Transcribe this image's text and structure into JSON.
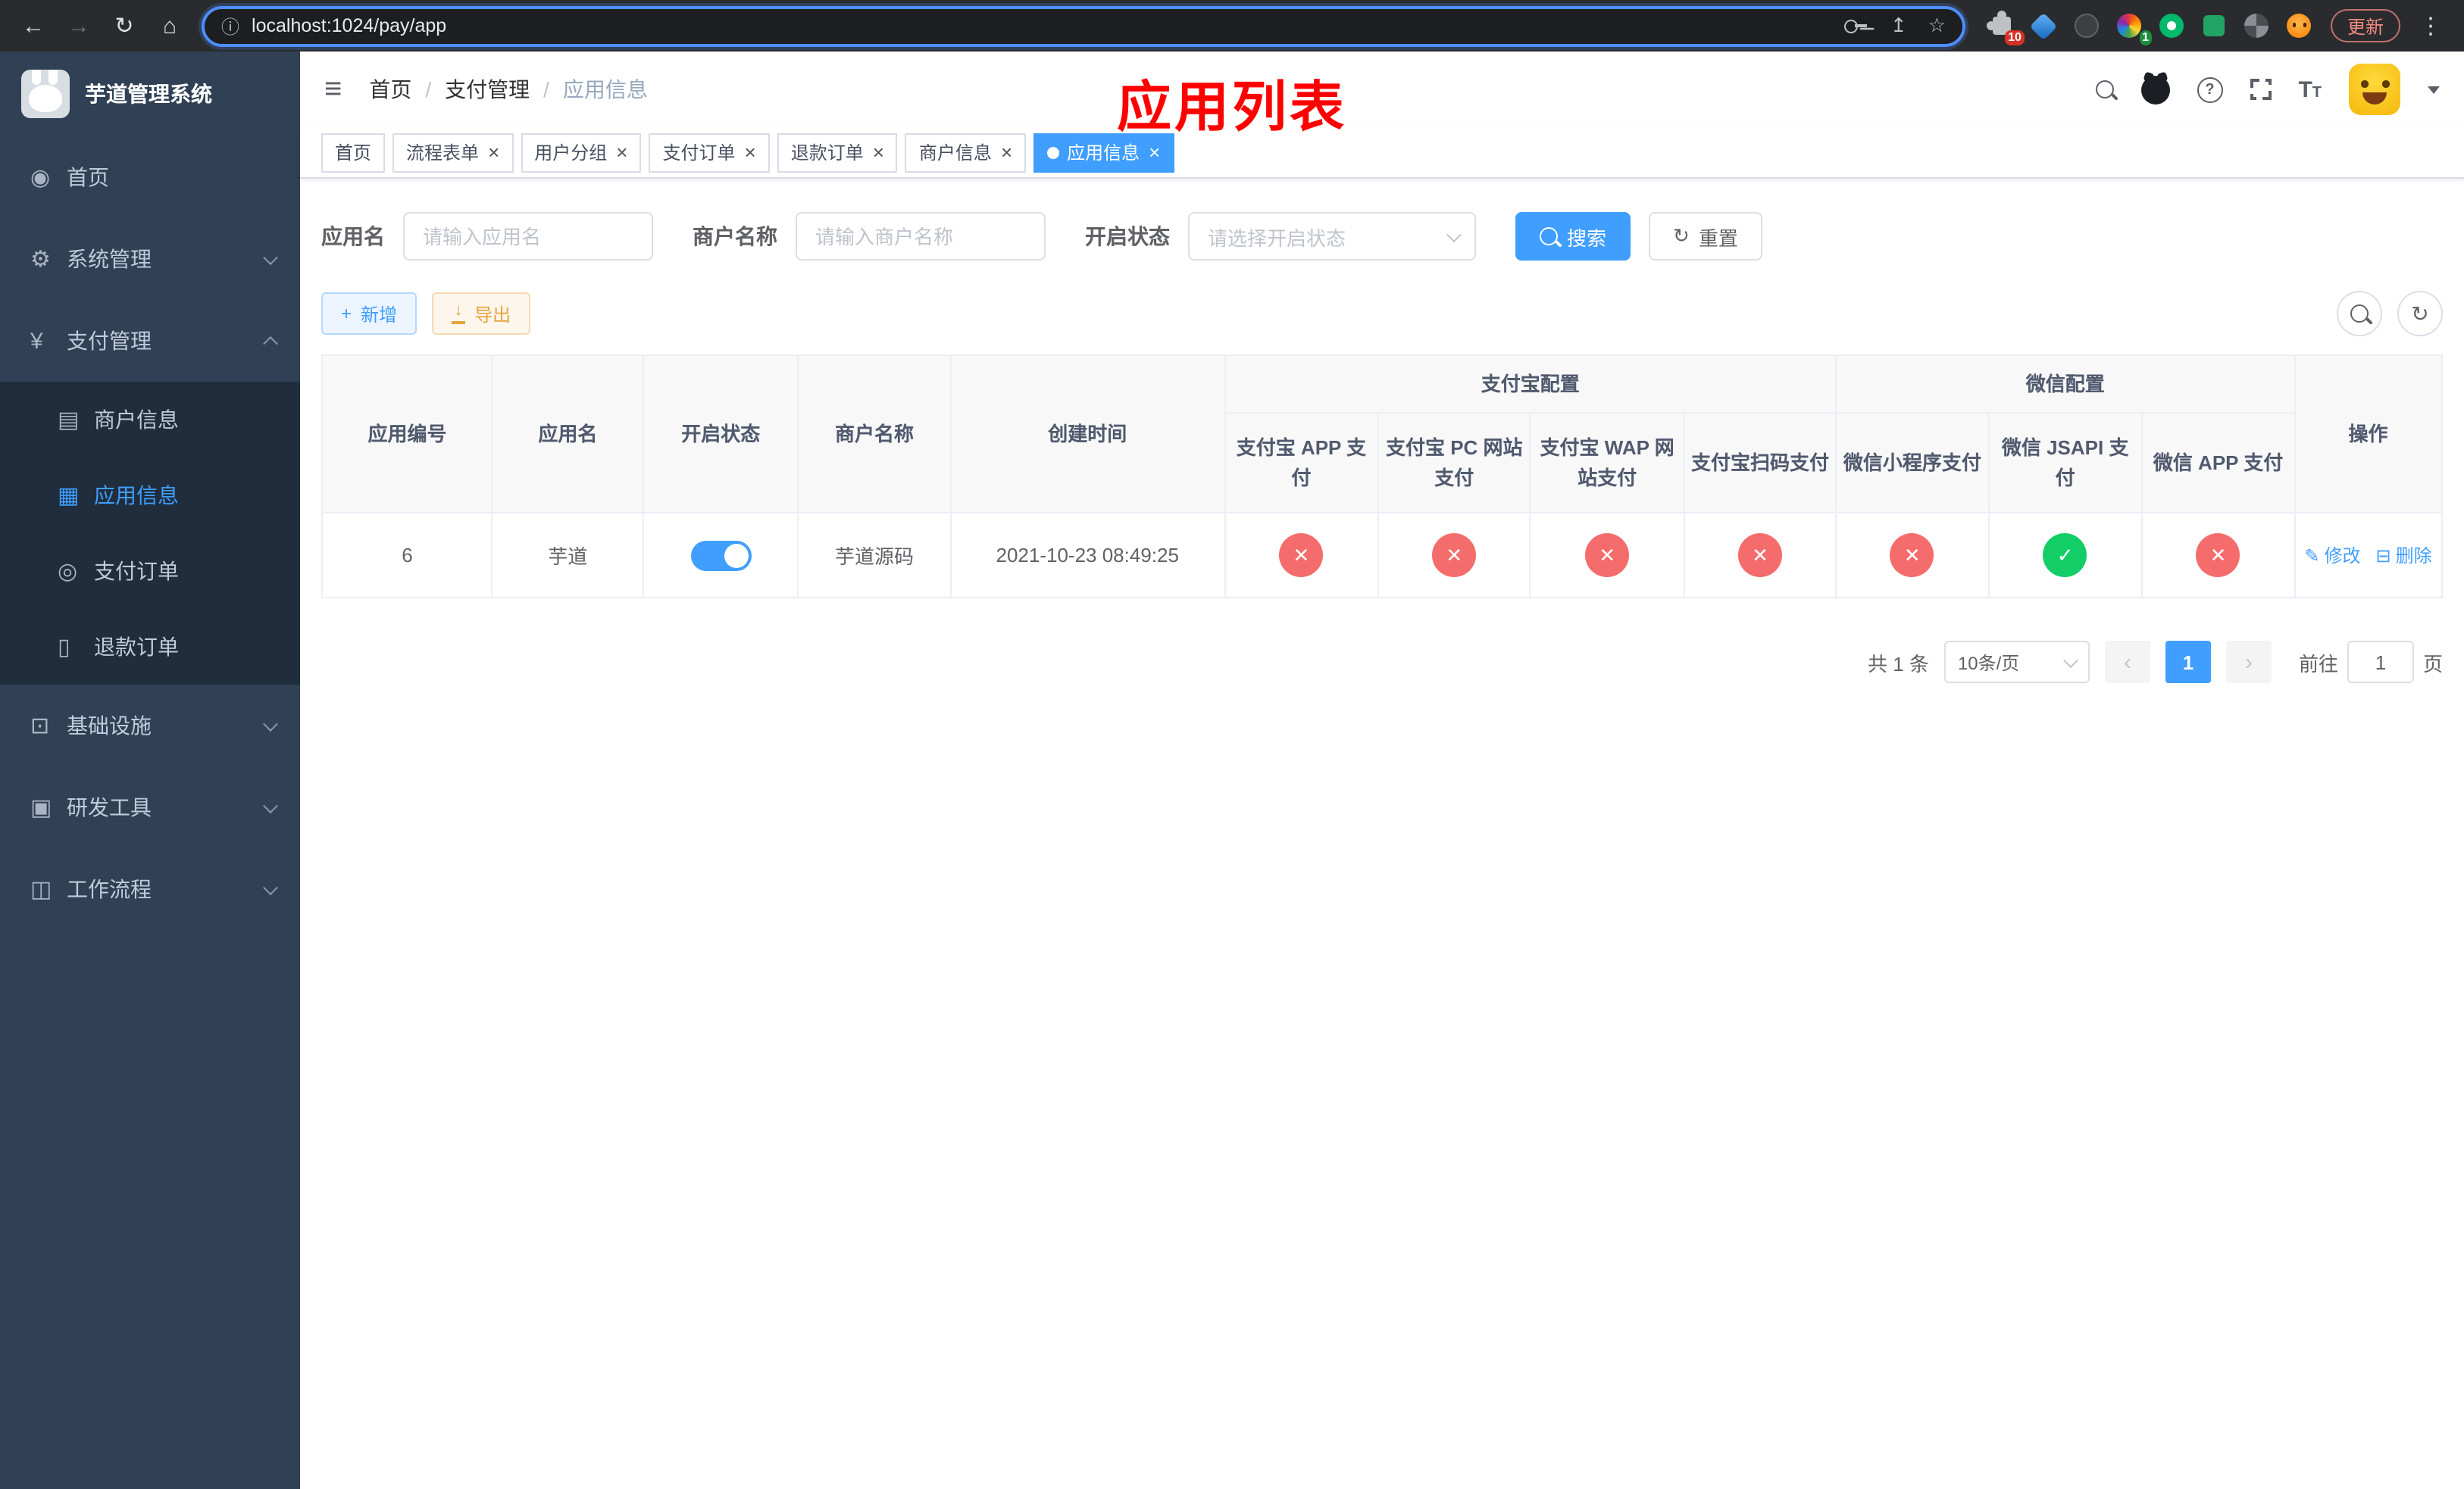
{
  "colors": {
    "accent": "#409EFF",
    "danger": "#F56C6C",
    "success": "#13CE66",
    "annotation": "#FF0000",
    "sidebar-bg": "#304156",
    "submenu-bg": "#1F2D3D"
  },
  "icons": {
    "back": "←",
    "forward": "→",
    "reload": "↻",
    "home": "⌂",
    "info": "ⓘ",
    "share": "↥",
    "star": "☆",
    "more": "⋮",
    "fold": "≡",
    "dashboard": "◉",
    "gear": "⚙",
    "yen": "¥",
    "merchant": "▤",
    "app": "▦",
    "order": "◎",
    "refund": "▯",
    "infra": "⊡",
    "devtool": "▣",
    "workflow": "◫",
    "question": "?",
    "font_big": "T",
    "font_small": "T",
    "plus": "+",
    "download": "↓",
    "refresh": "↻",
    "edit": "✎",
    "delete": "⊟",
    "prev": "‹",
    "next": "›",
    "check": "✓",
    "cross": "✕",
    "close": "×"
  },
  "browser": {
    "url": "localhost:1024/pay/app",
    "update_button": "更新",
    "ext_badge_1": "10",
    "ext_badge_2": "1"
  },
  "sidebar": {
    "title": "芋道管理系统",
    "menu": [
      {
        "label": "首页"
      },
      {
        "label": "系统管理"
      },
      {
        "label": "支付管理"
      },
      {
        "label": "基础设施"
      },
      {
        "label": "研发工具"
      },
      {
        "label": "工作流程"
      }
    ],
    "submenu": [
      {
        "label": "商户信息"
      },
      {
        "label": "应用信息"
      },
      {
        "label": "支付订单"
      },
      {
        "label": "退款订单"
      }
    ]
  },
  "header": {
    "breadcrumb": [
      "首页",
      "支付管理",
      "应用信息"
    ],
    "separator": "/",
    "overlay_title": "应用列表"
  },
  "tabs": [
    {
      "label": "首页"
    },
    {
      "label": "流程表单"
    },
    {
      "label": "用户分组"
    },
    {
      "label": "支付订单"
    },
    {
      "label": "退款订单"
    },
    {
      "label": "商户信息"
    },
    {
      "label": "应用信息"
    }
  ],
  "filters": {
    "app_name_label": "应用名",
    "app_name_placeholder": "请输入应用名",
    "merchant_label": "商户名称",
    "merchant_placeholder": "请输入商户名称",
    "status_label": "开启状态",
    "status_placeholder": "请选择开启状态",
    "search_button": "搜索",
    "reset_button": "重置"
  },
  "toolbar": {
    "add_button": "新增",
    "export_button": "导出"
  },
  "table": {
    "headers": {
      "app_id": "应用编号",
      "app_name": "应用名",
      "status": "开启状态",
      "merchant": "商户名称",
      "created": "创建时间",
      "alipay_group": "支付宝配置",
      "wechat_group": "微信配置",
      "alipay_app": "支付宝 APP 支付",
      "alipay_pc": "支付宝 PC 网站支付",
      "alipay_wap": "支付宝 WAP 网站支付",
      "alipay_qr": "支付宝扫码支付",
      "wx_lite": "微信小程序支付",
      "wx_jsapi": "微信 JSAPI 支付",
      "wx_app": "微信 APP 支付",
      "actions": "操作"
    },
    "rows": [
      {
        "id": "6",
        "name": "芋道",
        "enabled": true,
        "merchant": "芋道源码",
        "created": "2021-10-23 08:49:25",
        "payments": {
          "alipay_app": false,
          "alipay_pc": false,
          "alipay_wap": false,
          "alipay_qr": false,
          "wx_lite": false,
          "wx_jsapi": true,
          "wx_app": false
        },
        "edit_label": "修改",
        "delete_label": "删除"
      }
    ]
  },
  "pagination": {
    "total": "共 1 条",
    "page_size": "10条/页",
    "page": "1",
    "goto_label": "前往",
    "goto_value": "1",
    "goto_unit": "页"
  }
}
